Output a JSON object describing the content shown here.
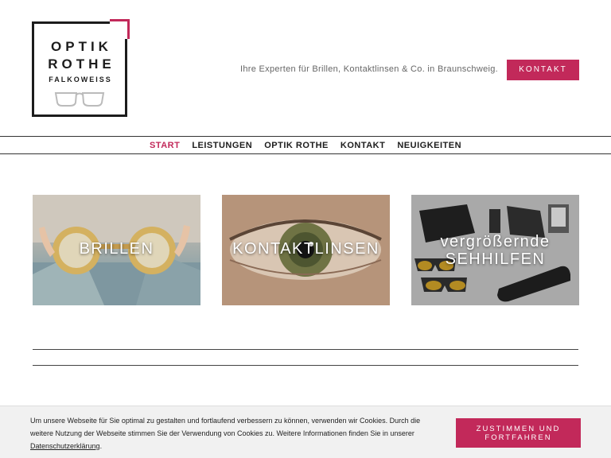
{
  "logo": {
    "line1": "OPTIK",
    "line2": "ROTHE",
    "line3": "FALKOWEISS"
  },
  "header": {
    "tagline": "Ihre Experten für Brillen, Kontaktlinsen & Co. in Braunschweig.",
    "contact_button": "KONTAKT"
  },
  "nav": {
    "items": [
      {
        "label": "START",
        "active": true
      },
      {
        "label": "LEISTUNGEN"
      },
      {
        "label": "OPTIK ROTHE"
      },
      {
        "label": "KONTAKT"
      },
      {
        "label": "NEUIGKEITEN"
      }
    ]
  },
  "tiles": [
    {
      "label": "BRILLEN"
    },
    {
      "label": "KONTAKTLINSEN"
    },
    {
      "label_line1": "vergrößernde",
      "label_line2": "SEHHILFEN"
    }
  ],
  "cookie": {
    "text": "Um unsere Webseite für Sie optimal zu gestalten und fortlaufend verbessern zu können, verwenden wir Cookies. Durch die weitere Nutzung der Webseite stimmen Sie der Verwendung von Cookies zu. Weitere Informationen finden Sie in unserer ",
    "link": "Datenschutzerklärung",
    "after": ".",
    "button_line1": "ZUSTIMMEN UND",
    "button_line2": "FORTFAHREN"
  },
  "colors": {
    "accent": "#c2295a",
    "text": "#1c1c1c"
  }
}
